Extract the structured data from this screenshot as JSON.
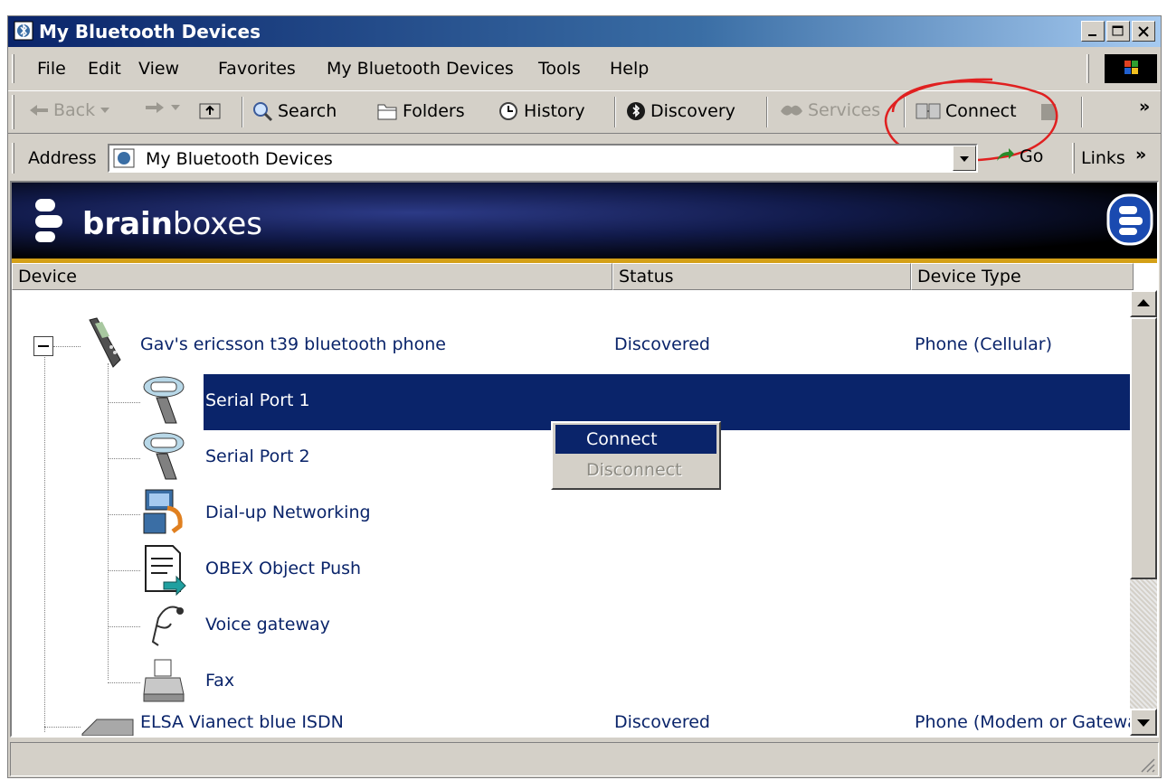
{
  "window": {
    "title": "My Bluetooth Devices"
  },
  "menu": [
    "File",
    "Edit",
    "View",
    "Favorites",
    "My Bluetooth Devices",
    "Tools",
    "Help"
  ],
  "toolbar": {
    "back": "Back",
    "search": "Search",
    "folders": "Folders",
    "history": "History",
    "discovery": "Discovery",
    "services": "Services",
    "connect": "Connect",
    "more": "»"
  },
  "address": {
    "label": "Address",
    "value": "My Bluetooth Devices",
    "go": "Go",
    "links": "Links",
    "links_more": "»"
  },
  "banner": {
    "brand_bold": "brain",
    "brand_rest": "boxes"
  },
  "columns": {
    "device": "Device",
    "status": "Status",
    "device_type": "Device Type"
  },
  "devices": [
    {
      "name": "Gav's ericsson t39 bluetooth phone",
      "status": "Discovered",
      "type": "Phone (Cellular)"
    },
    {
      "name": "ELSA Vianect blue ISDN",
      "status": "Discovered",
      "type": "Phone (Modem or Gatewa"
    }
  ],
  "services": [
    {
      "name": "Serial Port 1",
      "icon": "serial-port-icon"
    },
    {
      "name": "Serial Port 2",
      "icon": "serial-port-icon"
    },
    {
      "name": "Dial-up Networking",
      "icon": "dialup-networking-icon"
    },
    {
      "name": "OBEX Object Push",
      "icon": "obex-push-icon"
    },
    {
      "name": "Voice gateway",
      "icon": "headset-icon"
    },
    {
      "name": "Fax",
      "icon": "fax-icon"
    }
  ],
  "context_menu": {
    "connect": "Connect",
    "disconnect": "Disconnect"
  },
  "colors": {
    "title_start": "#0a246a",
    "selection": "#0a246a",
    "banner_accent": "#d4a017",
    "annotation": "#e02020"
  }
}
